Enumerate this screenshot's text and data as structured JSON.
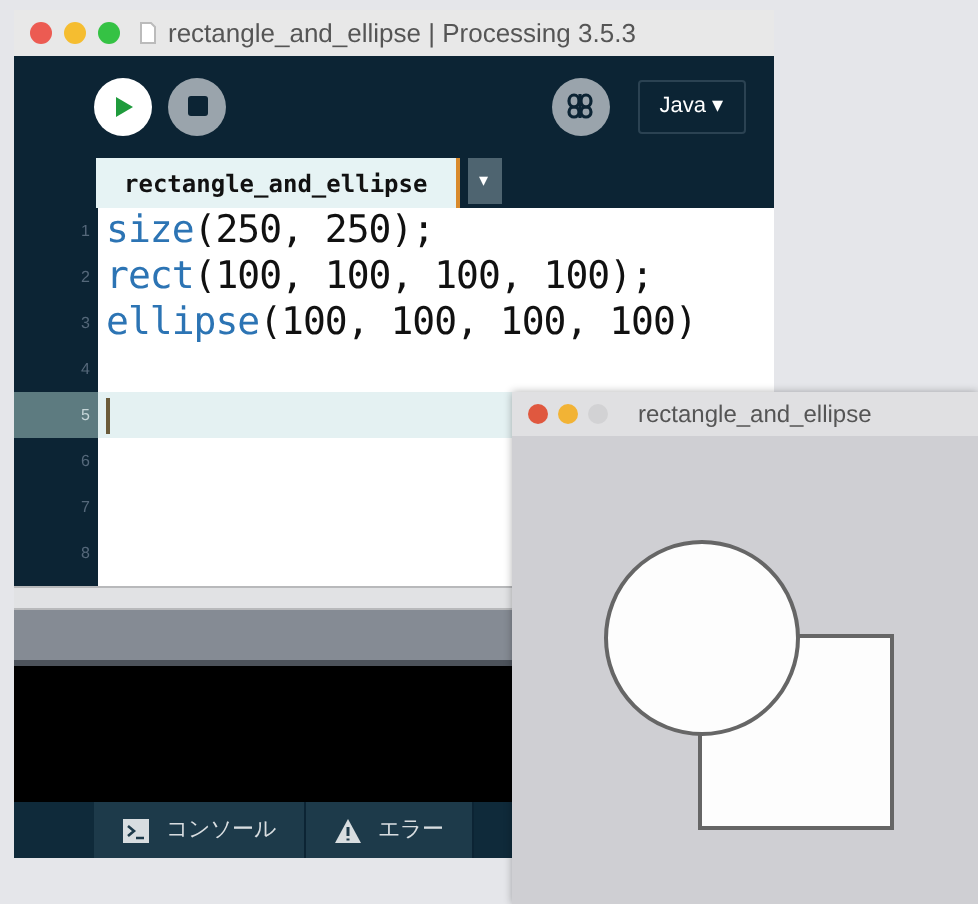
{
  "ide_window": {
    "title": "rectangle_and_ellipse | Processing 3.5.3",
    "toolbar": {
      "mode": "Java ▾"
    },
    "tabs": [
      {
        "label": "rectangle_and_ellipse",
        "selected": true
      }
    ],
    "tab_menu": "▾",
    "editor": {
      "lines": [
        {
          "number": "1",
          "keyword": "size",
          "rest": "(250, 250);",
          "selected": false
        },
        {
          "number": "2",
          "keyword": "rect",
          "rest": "(100, 100, 100, 100);",
          "selected": false
        },
        {
          "number": "3",
          "keyword": "ellipse",
          "rest": "(100, 100, 100, 100)",
          "selected": false
        },
        {
          "number": "4",
          "selected": false
        },
        {
          "number": "5",
          "selected": true
        },
        {
          "number": "6",
          "selected": false
        },
        {
          "number": "7",
          "selected": false
        },
        {
          "number": "8",
          "selected": false
        }
      ]
    },
    "bottom_tabs": [
      {
        "kind": "console",
        "label": "コンソール"
      },
      {
        "kind": "errors",
        "label": "エラー"
      }
    ]
  },
  "sketch_window": {
    "title": "rectangle_and_ellipse"
  }
}
